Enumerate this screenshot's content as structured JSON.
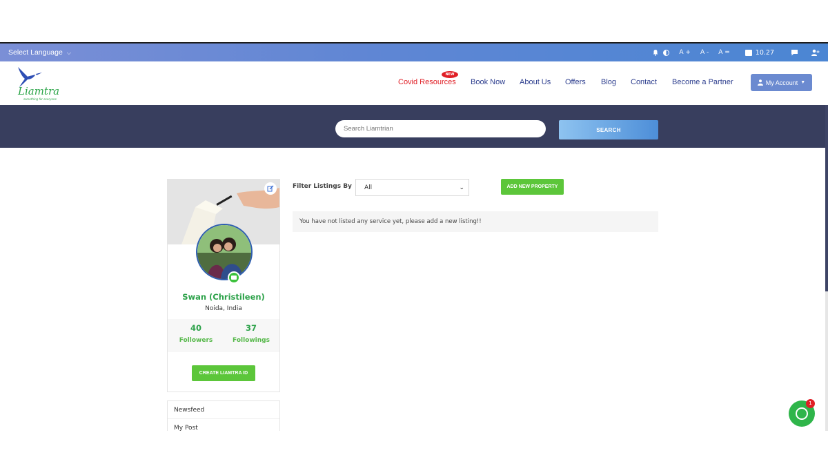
{
  "topbar": {
    "language_label": "Select Language",
    "font_increase": "A +",
    "font_decrease": "A -",
    "font_reset": "A =",
    "time": "10.27"
  },
  "header": {
    "logo_text": "Liamtra",
    "logo_tagline": "something for everyone",
    "new_badge": "NEW",
    "nav": [
      "Covid Resources",
      "Book Now",
      "About Us",
      "Offers",
      "Blog",
      "Contact",
      "Become a Partner"
    ],
    "account_label": "My Account"
  },
  "search": {
    "placeholder": "Search Liamtrian",
    "button_label": "SEARCH"
  },
  "profile": {
    "name": "Swan (Christileen)",
    "location": "Noida, India",
    "followers_count": "40",
    "followers_label": "Followers",
    "followings_count": "37",
    "followings_label": "Followings",
    "create_button": "CREATE LIAMTRA ID"
  },
  "side_menu": [
    "Newsfeed",
    "My Post"
  ],
  "listings": {
    "filter_label": "Filter Listings By",
    "filter_value": "All",
    "add_button": "ADD NEW PROPERTY",
    "empty_message": "You have not listed any service yet, please add a new listing!!"
  },
  "chat": {
    "unread_count": "1"
  },
  "colors": {
    "accent_green": "#5cc63a",
    "nav_blue": "#2d3e8e",
    "covid_red": "#e01f26",
    "band_dark": "#383e5e"
  }
}
